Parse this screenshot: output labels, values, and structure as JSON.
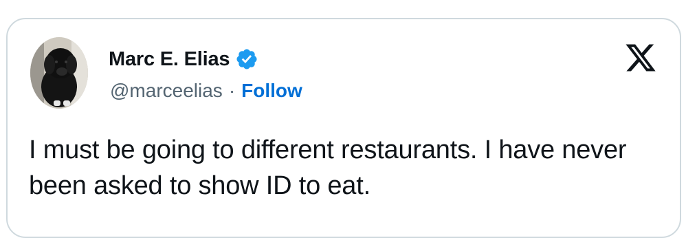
{
  "author": {
    "name": "Marc E. Elias",
    "handle": "@marceelias",
    "separator": "·",
    "follow_label": "Follow",
    "verified": true,
    "verified_color": "#1d9bf0"
  },
  "tweet": {
    "text": "I must be going to different restaurants. I have never been asked to show ID to eat."
  },
  "icons": {
    "brand": "x-logo-icon",
    "badge": "verified-badge-icon",
    "avatar": "dog-photo-avatar"
  },
  "colors": {
    "text": "#0f1419",
    "secondary": "#536471",
    "link": "#006fd6",
    "border": "#cfd9de"
  }
}
